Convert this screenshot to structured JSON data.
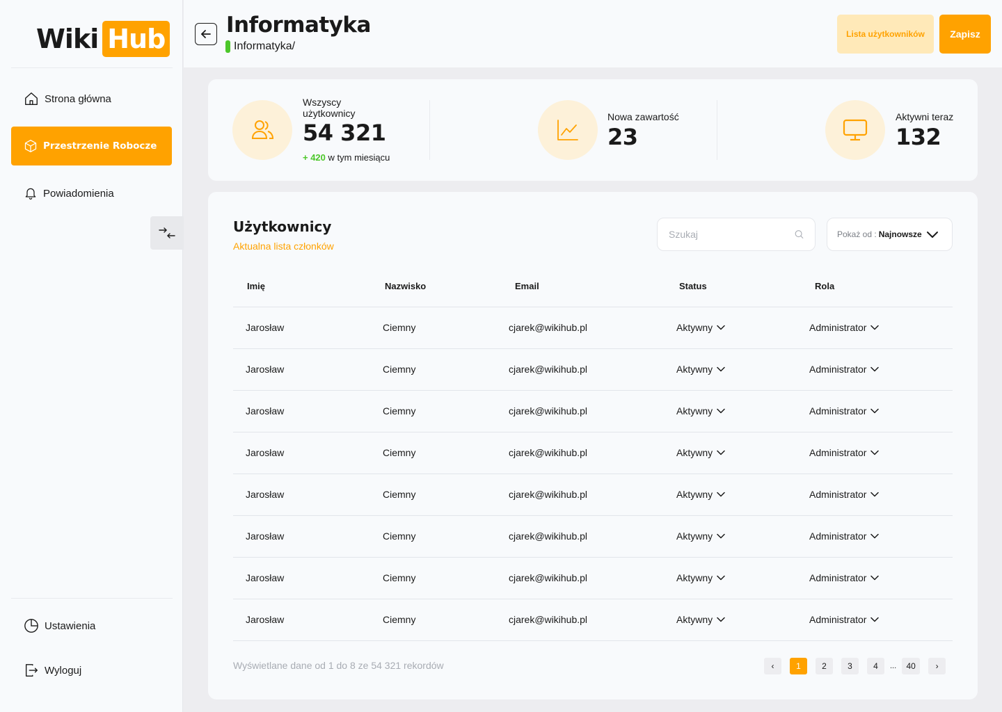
{
  "app": {
    "logo_wiki": "Wiki",
    "logo_hub": "Hub"
  },
  "sidebar": {
    "items": [
      {
        "label": "Strona główna",
        "icon": "home-icon"
      },
      {
        "label": "Przestrzenie Robocze",
        "icon": "cube-icon",
        "active": true
      },
      {
        "label": "Powiadomienia",
        "icon": "bell-icon"
      }
    ],
    "bottom_items": [
      {
        "label": "Ustawienia",
        "icon": "pie-chart-icon"
      },
      {
        "label": "Wyloguj",
        "icon": "logout-icon"
      }
    ]
  },
  "header": {
    "title": "Informatyka",
    "breadcrumb": "Informatyka/",
    "users_list_label": "Lista użytkowników",
    "save_label": "Zapisz"
  },
  "stats": {
    "users": {
      "label": "Wszyscy użytkownicy",
      "value": "54 321",
      "delta": "+ 420",
      "delta_text": "w tym miesiącu"
    },
    "content": {
      "label": "Nowa zawartość",
      "value": "23"
    },
    "active": {
      "label": "Aktywni teraz",
      "value": "132"
    }
  },
  "users_panel": {
    "title": "Użytkownicy",
    "subtitle": "Aktualna lista członków",
    "search_placeholder": "Szukaj",
    "sort_prefix": "Pokaż od :",
    "sort_value": "Najnowsze",
    "columns": [
      "Imię",
      "Nazwisko",
      "Email",
      "Status",
      "Rola"
    ],
    "rows": [
      {
        "first": "Jarosław",
        "last": "Ciemny",
        "email": "cjarek@wikihub.pl",
        "status": "Aktywny",
        "role": "Administrator"
      },
      {
        "first": "Jarosław",
        "last": "Ciemny",
        "email": "cjarek@wikihub.pl",
        "status": "Aktywny",
        "role": "Administrator"
      },
      {
        "first": "Jarosław",
        "last": "Ciemny",
        "email": "cjarek@wikihub.pl",
        "status": "Aktywny",
        "role": "Administrator"
      },
      {
        "first": "Jarosław",
        "last": "Ciemny",
        "email": "cjarek@wikihub.pl",
        "status": "Aktywny",
        "role": "Administrator"
      },
      {
        "first": "Jarosław",
        "last": "Ciemny",
        "email": "cjarek@wikihub.pl",
        "status": "Aktywny",
        "role": "Administrator"
      },
      {
        "first": "Jarosław",
        "last": "Ciemny",
        "email": "cjarek@wikihub.pl",
        "status": "Aktywny",
        "role": "Administrator"
      },
      {
        "first": "Jarosław",
        "last": "Ciemny",
        "email": "cjarek@wikihub.pl",
        "status": "Aktywny",
        "role": "Administrator"
      },
      {
        "first": "Jarosław",
        "last": "Ciemny",
        "email": "cjarek@wikihub.pl",
        "status": "Aktywny",
        "role": "Administrator"
      }
    ],
    "footer_text": "Wyświetlane dane od 1 do 8 ze 54 321 rekordów",
    "pagination": {
      "prev": "‹",
      "pages": [
        "1",
        "2",
        "3",
        "4"
      ],
      "ellipsis": "...",
      "last": "40",
      "next": "›",
      "current": "1"
    }
  },
  "colors": {
    "accent": "#ffa200",
    "accent_light": "#ffe9b8",
    "success": "#4cc72a"
  }
}
